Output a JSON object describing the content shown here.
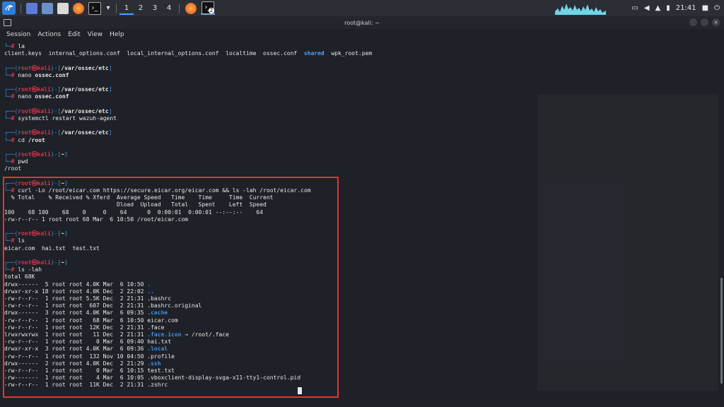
{
  "taskbar": {
    "workspaces": [
      "1",
      "2",
      "3",
      "4"
    ],
    "task_badge": "2",
    "clock": "21:41"
  },
  "window": {
    "title": "root@kali: ~"
  },
  "menu": [
    "Session",
    "Actions",
    "Edit",
    "View",
    "Help"
  ],
  "prompt": {
    "user": "root",
    "at": "㉿",
    "host": "kali",
    "hash": "#"
  },
  "terminal": {
    "ls_la_cmd": "la",
    "ls_la_output_a": "client.keys  internal_options.conf  local_internal_options.conf  localtime  ossec.conf  ",
    "ls_la_shared": "shared",
    "ls_la_output_b": "  wpk_root.pem",
    "blocks": [
      {
        "dir": "/var/ossec/etc",
        "cmd": "nano",
        "arg": "ossec.conf"
      },
      {
        "dir": "/var/ossec/etc",
        "cmd": "nano",
        "arg": "ossec.conf"
      },
      {
        "dir": "/var/ossec/etc",
        "cmd": "systemctl restart wazuh-agent",
        "arg": ""
      },
      {
        "dir": "/var/ossec/etc",
        "cmd": "cd",
        "arg": "/root"
      },
      {
        "dir": "~",
        "cmd": "pwd",
        "arg": ""
      }
    ],
    "pwd_output": "/root",
    "curl_dir": "~",
    "curl_cmd": "curl -Lo /root/eicar.com https://secure.eicar.org/eicar.com && ls -lah /root/eicar.com",
    "curl_header1": "  % Total    % Received % Xferd  Average Speed   Time    Time     Time  Current",
    "curl_header2": "                                 Dload  Upload   Total   Spent    Left  Speed",
    "curl_progress": "100    68 100    68    0     0    64      0  0:00:01  0:00:01 --:--:--    64",
    "curl_ls": "-rw-r--r-- 1 root root 68 Mar  6 10:50 /root/eicar.com",
    "ls_dir": "~",
    "ls_cmd": "ls",
    "ls_output": "eicar.com  hai.txt  test.txt",
    "lslah_dir": "~",
    "lslah_cmd": "ls -lah",
    "total": "total 68K",
    "files": [
      {
        "meta": "drwx------  5 root root 4.0K Mar  6 10:50 ",
        "name": ".",
        "type": "dir"
      },
      {
        "meta": "drwxr-xr-x 18 root root 4.0K Dec  2 22:02 ",
        "name": "..",
        "type": "dir"
      },
      {
        "meta": "-rw-r--r--  1 root root 5.5K Dec  2 21:31 ",
        "name": ".bashrc",
        "type": "file"
      },
      {
        "meta": "-rw-r--r--  1 root root  607 Dec  2 21:31 ",
        "name": ".bashrc.original",
        "type": "file"
      },
      {
        "meta": "drwx------  3 root root 4.0K Mar  6 09:35 ",
        "name": ".cache",
        "type": "dir"
      },
      {
        "meta": "-rw-r--r--  1 root root   68 Mar  6 10:50 ",
        "name": "eicar.com",
        "type": "file"
      },
      {
        "meta": "-rw-r--r--  1 root root  12K Dec  2 21:31 ",
        "name": ".face",
        "type": "file"
      },
      {
        "meta": "lrwxrwxrwx  1 root root   11 Dec  2 21:31 ",
        "name": ".face.icon",
        "type": "link",
        "target": " → /root/.face"
      },
      {
        "meta": "-rw-r--r--  1 root root    0 Mar  6 09:40 ",
        "name": "hai.txt",
        "type": "file"
      },
      {
        "meta": "drwxr-xr-x  3 root root 4.0K Mar  6 09:36 ",
        "name": ".local",
        "type": "dir"
      },
      {
        "meta": "-rw-r--r--  1 root root  132 Nov 10 04:50 ",
        "name": ".profile",
        "type": "file"
      },
      {
        "meta": "drwx------  2 root root 4.0K Dec  2 21:29 ",
        "name": ".ssh",
        "type": "dir"
      },
      {
        "meta": "-rw-r--r--  1 root root    0 Mar  6 10:15 ",
        "name": "test.txt",
        "type": "file"
      },
      {
        "meta": "-rw-------  1 root root    4 Mar  6 10:05 ",
        "name": ".vboxclient-display-svga-x11-tty1-control.pid",
        "type": "file"
      },
      {
        "meta": "-rw-r--r--  1 root root  11K Dec  2 21:31 ",
        "name": ".zshrc",
        "type": "file"
      }
    ]
  },
  "colors": {
    "prompt_red": "#e0304a",
    "dir_blue": "#3f8fe8",
    "highlight": "#e33333"
  }
}
